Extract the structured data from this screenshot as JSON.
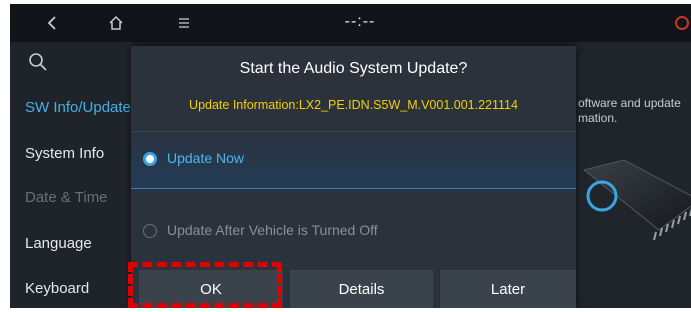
{
  "topbar": {
    "back_icon": "chevron-left-icon",
    "home_icon": "home-icon",
    "menu_icon": "hamburger-menu-icon",
    "clock": "--:--"
  },
  "sidebar": {
    "search_icon": "search-icon",
    "items": [
      {
        "label": "SW Info/Update",
        "state": "active"
      },
      {
        "label": "System Info",
        "state": "normal"
      },
      {
        "label": "Date & Time",
        "state": "disabled"
      },
      {
        "label": "Language",
        "state": "normal"
      },
      {
        "label": "Keyboard",
        "state": "normal"
      }
    ]
  },
  "background_panel": {
    "text_line1": "oftware and update",
    "text_line2": "mation."
  },
  "dialog": {
    "title": "Start the Audio System Update?",
    "info": "Update Information:LX2_PE.IDN.S5W_M.V001.001.221114",
    "options": [
      {
        "label": "Update Now",
        "selected": true
      },
      {
        "label": "Update After Vehicle is Turned Off",
        "selected": false
      }
    ],
    "buttons": {
      "ok": "OK",
      "details": "Details",
      "later": "Later"
    }
  },
  "colors": {
    "accent": "#3aa5e0",
    "info_text": "#f2d000",
    "highlight": "#e00000"
  }
}
